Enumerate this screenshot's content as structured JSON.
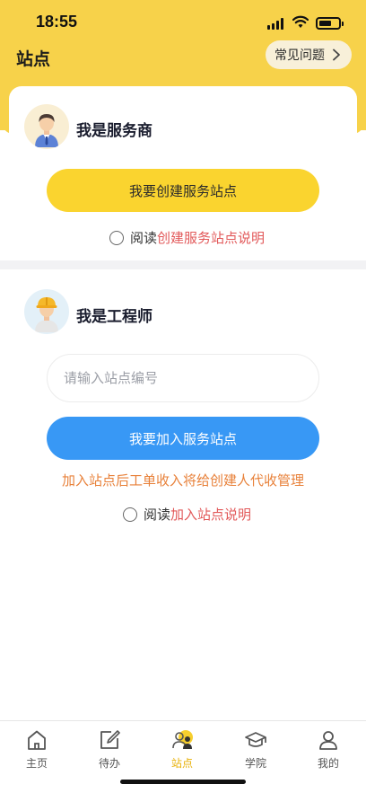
{
  "status_bar": {
    "time": "18:55"
  },
  "header": {
    "title": "站点",
    "faq_label": "常见问题"
  },
  "provider": {
    "title": "我是服务商",
    "create_button": "我要创建服务站点",
    "agree_prefix": "阅读",
    "agree_link": "创建服务站点说明"
  },
  "engineer": {
    "title": "我是工程师",
    "input_placeholder": "请输入站点编号",
    "input_value": "",
    "join_button": "我要加入服务站点",
    "notice": "加入站点后工单收入将给创建人代收管理",
    "agree_prefix": "阅读",
    "agree_link": "加入站点说明"
  },
  "tabbar": {
    "items": [
      {
        "label": "主页",
        "icon": "home-icon"
      },
      {
        "label": "待办",
        "icon": "edit-icon"
      },
      {
        "label": "站点",
        "icon": "station-icon",
        "active": true
      },
      {
        "label": "学院",
        "icon": "graduation-cap-icon"
      },
      {
        "label": "我的",
        "icon": "user-icon"
      }
    ]
  },
  "colors": {
    "brand_yellow": "#f7d24a",
    "button_yellow": "#fad42f",
    "button_blue": "#3898f5",
    "link_red": "#e2595a",
    "notice_orange": "#e8813a",
    "tab_active": "#e8b20a"
  }
}
